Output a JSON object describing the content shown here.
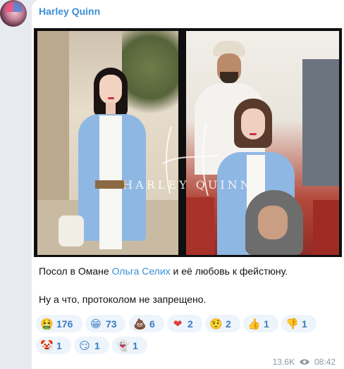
{
  "channel": {
    "name": "Harley Quinn"
  },
  "post": {
    "image_watermark": "HARLEY QUINN",
    "caption_part1": "Посол в Омане ",
    "caption_link": "Ольга Селих",
    "caption_part2": " и её любовь к фейстюну.",
    "caption_line2": "Ну а что, протоколом не запрещено."
  },
  "reactions": [
    {
      "icon": "nauseated-face-icon",
      "glyph": "🤮",
      "count": "176"
    },
    {
      "icon": "grinning-face-icon",
      "glyph": "😁",
      "count": "73"
    },
    {
      "icon": "pile-of-poo-icon",
      "glyph": "💩",
      "count": "6"
    },
    {
      "icon": "red-heart-icon",
      "glyph": "❤",
      "count": "2"
    },
    {
      "icon": "raised-eyebrow-face-icon",
      "glyph": "🤨",
      "count": "2"
    },
    {
      "icon": "thumbs-up-icon",
      "glyph": "👍",
      "count": "1"
    },
    {
      "icon": "thumbs-down-icon",
      "glyph": "👎",
      "count": "1"
    },
    {
      "icon": "clown-face-icon",
      "glyph": "🤡",
      "count": "1"
    },
    {
      "icon": "smirking-face-icon",
      "glyph": "😏",
      "count": "1"
    },
    {
      "icon": "ghost-icon",
      "glyph": "👻",
      "count": "1"
    }
  ],
  "meta": {
    "views": "13.6K",
    "time": "08:42"
  },
  "colors": {
    "accent": "#3a8fd6",
    "reaction_bg": "#eef4fb",
    "page_bg": "#e7ebf0"
  }
}
